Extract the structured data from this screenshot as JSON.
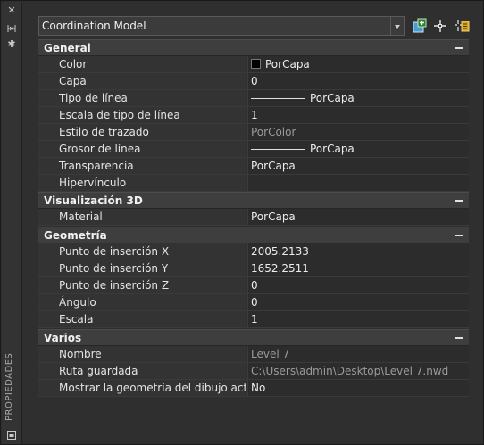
{
  "sidebar": {
    "vertical_title": "PROPIEDADES"
  },
  "toolbar": {
    "selection": "Coordination Model"
  },
  "sections": {
    "general": {
      "title": "General",
      "rows": [
        {
          "label": "Color",
          "value": "PorCapa"
        },
        {
          "label": "Capa",
          "value": "0"
        },
        {
          "label": "Tipo de línea",
          "value": "PorCapa"
        },
        {
          "label": "Escala de tipo de línea",
          "value": "1"
        },
        {
          "label": "Estilo de trazado",
          "value": "PorColor"
        },
        {
          "label": "Grosor de línea",
          "value": "PorCapa"
        },
        {
          "label": "Transparencia",
          "value": "PorCapa"
        },
        {
          "label": "Hipervínculo",
          "value": ""
        }
      ]
    },
    "vis3d": {
      "title": "Visualización 3D",
      "rows": [
        {
          "label": "Material",
          "value": "PorCapa"
        }
      ]
    },
    "geometria": {
      "title": "Geometría",
      "rows": [
        {
          "label": "Punto de inserción X",
          "value": "2005.2133"
        },
        {
          "label": "Punto de inserción Y",
          "value": "1652.2511"
        },
        {
          "label": "Punto de inserción Z",
          "value": "0"
        },
        {
          "label": "Ángulo",
          "value": "0"
        },
        {
          "label": "Escala",
          "value": "1"
        }
      ]
    },
    "varios": {
      "title": "Varios",
      "rows": [
        {
          "label": "Nombre",
          "value": "Level 7"
        },
        {
          "label": "Ruta guardada",
          "value": "C:\\Users\\admin\\Desktop\\Level 7.nwd"
        },
        {
          "label": "Mostrar la geometría del dibujo act...",
          "value": "No"
        }
      ]
    }
  }
}
